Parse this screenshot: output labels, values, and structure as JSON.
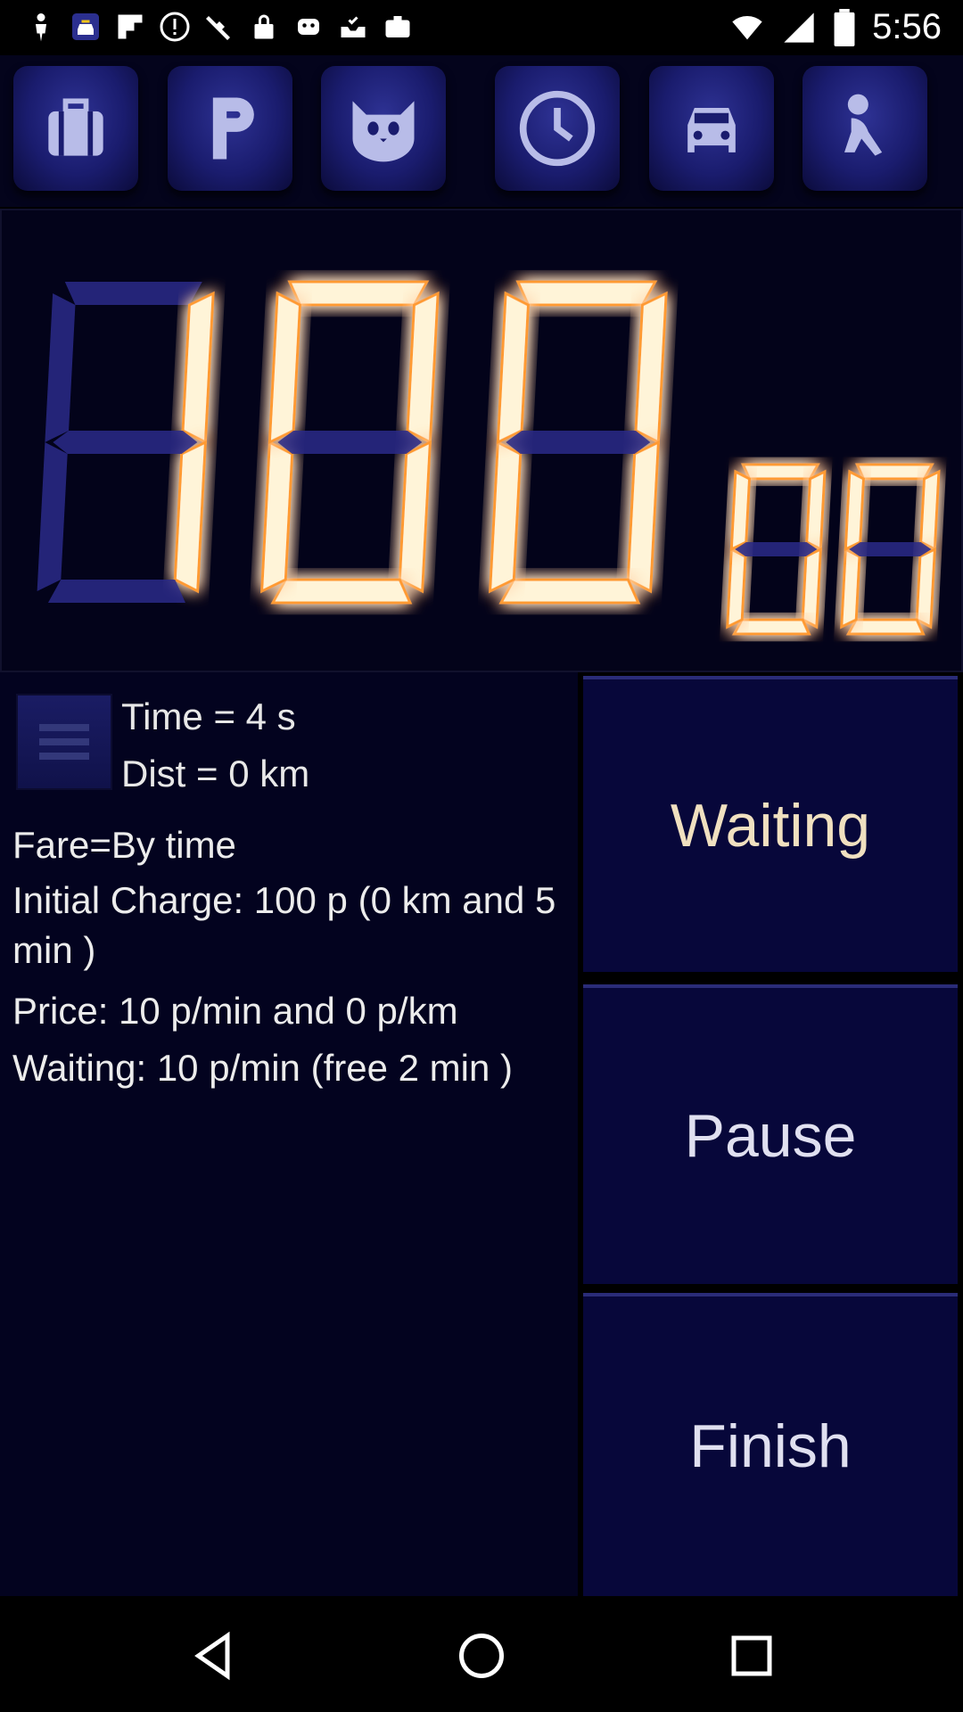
{
  "status_bar": {
    "time": "5:56",
    "icons": [
      "user-icon",
      "taxi-app-icon",
      "flipboard-icon",
      "info-icon",
      "satellite-icon",
      "lock-icon",
      "android-icon",
      "inbox-check-icon",
      "briefcase-icon"
    ]
  },
  "toolbar": {
    "buttons": [
      "luggage-icon",
      "parking-icon",
      "cat-icon",
      "clock-icon",
      "car-icon",
      "person-icon"
    ]
  },
  "meter": {
    "main_value": "100",
    "decimal_value": "00",
    "main_digit_color": "#fff4d8",
    "glow_color": "#ff9a30",
    "inactive_segment_color": "#2a2a8a"
  },
  "info": {
    "time_label": "Time = 4 s",
    "dist_label": "Dist = 0 km",
    "fare_mode": "Fare=By time",
    "initial_charge": "Initial Charge: 100 p (0 km and 5 min )",
    "price": "Price: 10 p/min and 0 p/km",
    "waiting": "Waiting: 10 p/min (free 2 min )"
  },
  "actions": {
    "waiting_label": "Waiting",
    "pause_label": "Pause",
    "finish_label": "Finish"
  },
  "nav": [
    "back-icon",
    "home-icon",
    "recents-icon"
  ]
}
